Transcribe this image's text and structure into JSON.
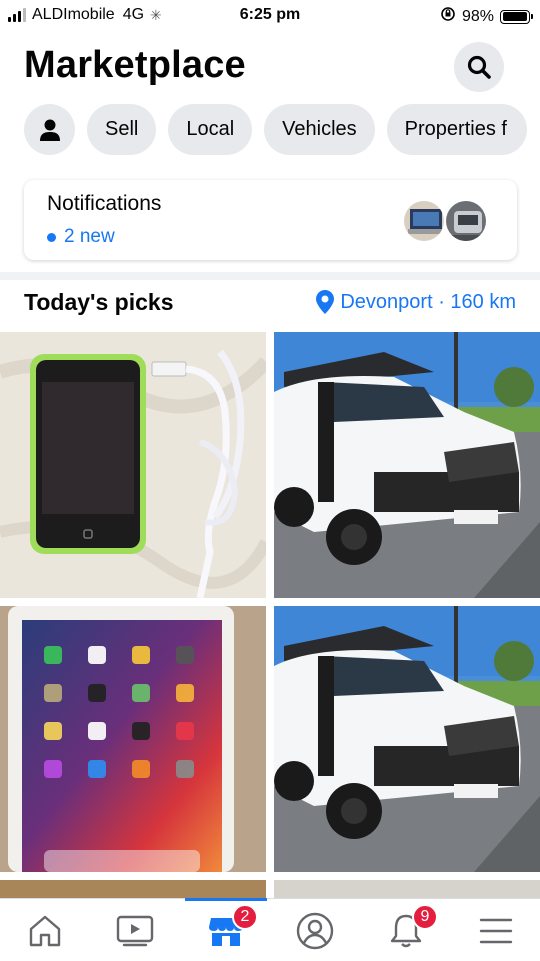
{
  "status_bar": {
    "carrier": "ALDImobile",
    "network": "4G",
    "time": "6:25 pm",
    "battery": "98%",
    "battery_level": 0.98
  },
  "header": {
    "title": "Marketplace",
    "search_icon": "search-icon"
  },
  "chips": {
    "profile_icon": "person-icon",
    "sell": "Sell",
    "local": "Local",
    "vehicles": "Vehicles",
    "properties": "Properties f"
  },
  "notifications": {
    "heading": "Notifications",
    "new_label": "2 new"
  },
  "picks": {
    "title": "Today's picks",
    "location": "Devonport · 160 km"
  },
  "bottom_nav": {
    "items": [
      {
        "icon": "home-icon"
      },
      {
        "icon": "video-icon"
      },
      {
        "icon": "marketplace-icon",
        "badge": "2",
        "active": true
      },
      {
        "icon": "profile-icon"
      },
      {
        "icon": "bell-icon",
        "badge": "9"
      },
      {
        "icon": "menu-icon"
      }
    ]
  },
  "colors": {
    "accent": "#1877f2",
    "chip_bg": "#e7e9ec",
    "badge": "#e41e3f"
  }
}
